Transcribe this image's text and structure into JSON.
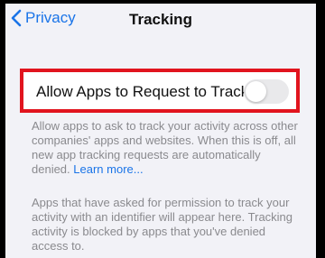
{
  "nav": {
    "back_label": "Privacy",
    "title": "Tracking"
  },
  "setting": {
    "label": "Allow Apps to Request to Track",
    "toggle_on": false
  },
  "footer": {
    "description": "Allow apps to ask to track your activity across other companies' apps and websites. When this is off, all new app tracking requests are automatically denied.",
    "learn_more": "Learn more...",
    "info": "Apps that have asked for permission to track your activity with an identifier will appear here. Tracking activity is blocked by apps that you've denied access to."
  },
  "colors": {
    "accent": "#1a74e8",
    "highlight_border": "#e1141e",
    "toggle_off": "#e9e9eb"
  }
}
